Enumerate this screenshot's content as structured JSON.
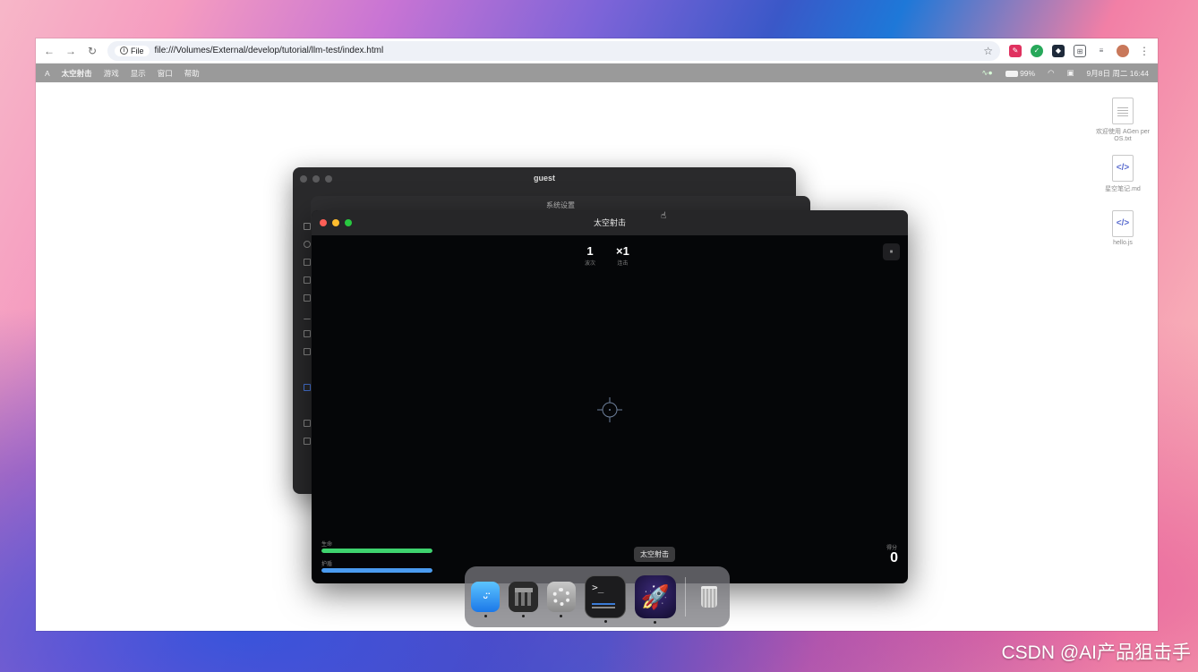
{
  "browser": {
    "back": "←",
    "forward": "→",
    "reload": "↻",
    "scheme_chip": "File",
    "url": "file:///Volumes/External/develop/tutorial/llm-test/index.html",
    "star": "☆",
    "ext_menu": "⋮"
  },
  "menubar": {
    "logo": "A",
    "app": "太空射击",
    "items": [
      "游戏",
      "显示",
      "窗口",
      "帮助"
    ],
    "battery": "99%",
    "datetime": "9月8日 周二  16:44"
  },
  "desktop_icons": [
    {
      "label": "欢迎使用 AGen per OS.txt"
    },
    {
      "label": "星空笔记.md"
    },
    {
      "label": "hello.js"
    }
  ],
  "windows": {
    "back_title": "guest",
    "mid_title": "系统设置",
    "game": {
      "title": "太空射击",
      "hud": {
        "wave": {
          "value": "1",
          "label": "波次"
        },
        "combo": {
          "value": "×1",
          "label": "连击"
        }
      },
      "pause": "⏸",
      "health_label": "生命",
      "health": 1.0,
      "energy_label": "护盾",
      "energy": 1.0,
      "score_label": "得分",
      "score": "0"
    }
  },
  "dock": {
    "tooltip": "太空射击",
    "apps": [
      "finder-icon",
      "calculator-icon",
      "settings-icon",
      "terminal-icon",
      "rocket-icon",
      "trash-icon"
    ]
  },
  "watermark": "CSDN @AI产品狙击手",
  "colors": {
    "health": "#3ed36e",
    "energy": "#4a9bf0",
    "traffic_red": "#ff5f57",
    "traffic_yellow": "#febc2e",
    "traffic_green": "#28c840"
  }
}
